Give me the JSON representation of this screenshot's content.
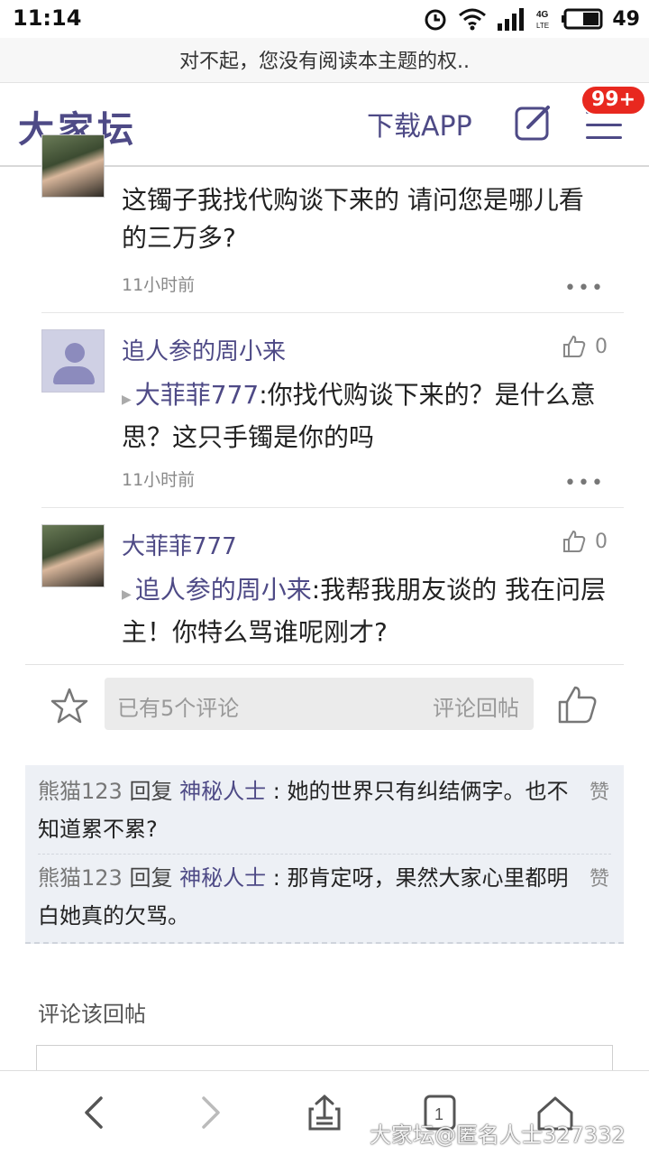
{
  "status_bar": {
    "time": "11:14",
    "battery": "49"
  },
  "page_title": "对不起，您没有阅读本主题的权..",
  "header": {
    "logo": "大家坛",
    "download": "下载APP",
    "badge": "99+"
  },
  "comments": [
    {
      "text": "这镯子我找代购谈下来的 请问您是哪儿看的三万多?",
      "time": "11小时前",
      "more": "•••"
    },
    {
      "name": "追人参的周小来",
      "likes": "0",
      "mention": "大菲菲777",
      "text": ":你找代购谈下来的？是什么意思？这只手镯是你的吗",
      "time": "11小时前",
      "more": "•••"
    },
    {
      "name": "大菲菲777",
      "likes": "0",
      "mention": "追人参的周小来",
      "text": ":我帮我朋友谈的 我在问层主！你特么骂谁呢刚才?"
    }
  ],
  "input_bar": {
    "placeholder": "已有5个评论",
    "reply_label": "评论回帖"
  },
  "sub_replies": [
    {
      "user": "熊猫123",
      "action": "回复",
      "target": "神秘人士",
      "text": ": 她的世界只有纠结俩字。也不知道累不累?",
      "zan": "赞"
    },
    {
      "user": "熊猫123",
      "action": "回复",
      "target": "神秘人士",
      "text": ": 那肯定呀，果然大家心里都明白她真的欠骂。",
      "zan": "赞"
    }
  ],
  "comment_label": "评论该回帖",
  "watermark": "大家坛@匿名人士327332",
  "tab_count": "1",
  "colors": {
    "brand": "#4e4a86",
    "badge": "#e8281f",
    "reply_bg": "#edf0f5"
  }
}
